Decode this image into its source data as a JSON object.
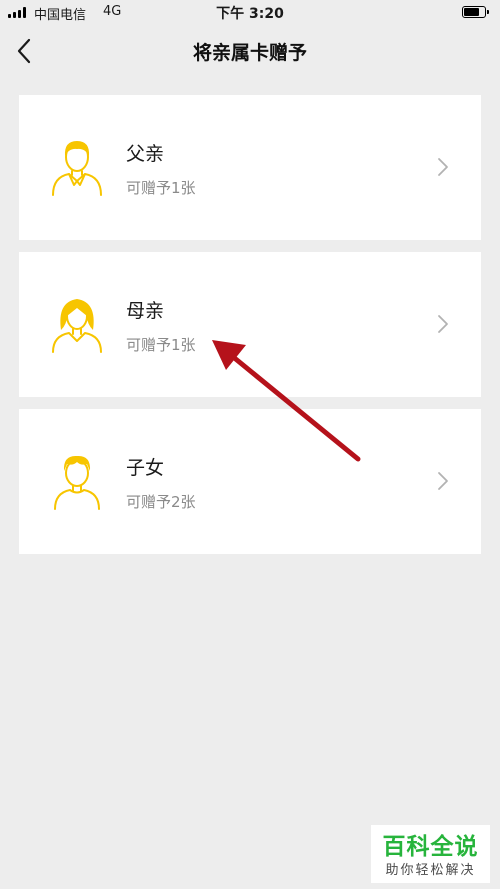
{
  "status_bar": {
    "carrier": "中国电信",
    "network": "4G",
    "time": "下午 3:20",
    "signal_icon": "signal-bars-icon",
    "battery_icon": "battery-icon",
    "battery_level": 0.85
  },
  "nav": {
    "back_icon": "chevron-left-icon",
    "title": "将亲属卡赠予"
  },
  "cards": [
    {
      "title": "父亲",
      "subtitle": "可赠予1张",
      "avatar_icon": "father-avatar-icon",
      "chevron_icon": "chevron-right-icon"
    },
    {
      "title": "母亲",
      "subtitle": "可赠予1张",
      "avatar_icon": "mother-avatar-icon",
      "chevron_icon": "chevron-right-icon"
    },
    {
      "title": "子女",
      "subtitle": "可赠予2张",
      "avatar_icon": "child-avatar-icon",
      "chevron_icon": "chevron-right-icon"
    }
  ],
  "watermark": {
    "main": "百科全说",
    "sub": "助你轻松解决"
  },
  "colors": {
    "background": "#ededed",
    "card": "#ffffff",
    "avatar": "#f7c500",
    "subtitle": "#8a8a8a",
    "chevron": "#b2b2b2",
    "annotation_arrow": "#b5121b",
    "watermark_green": "#27b43c"
  }
}
